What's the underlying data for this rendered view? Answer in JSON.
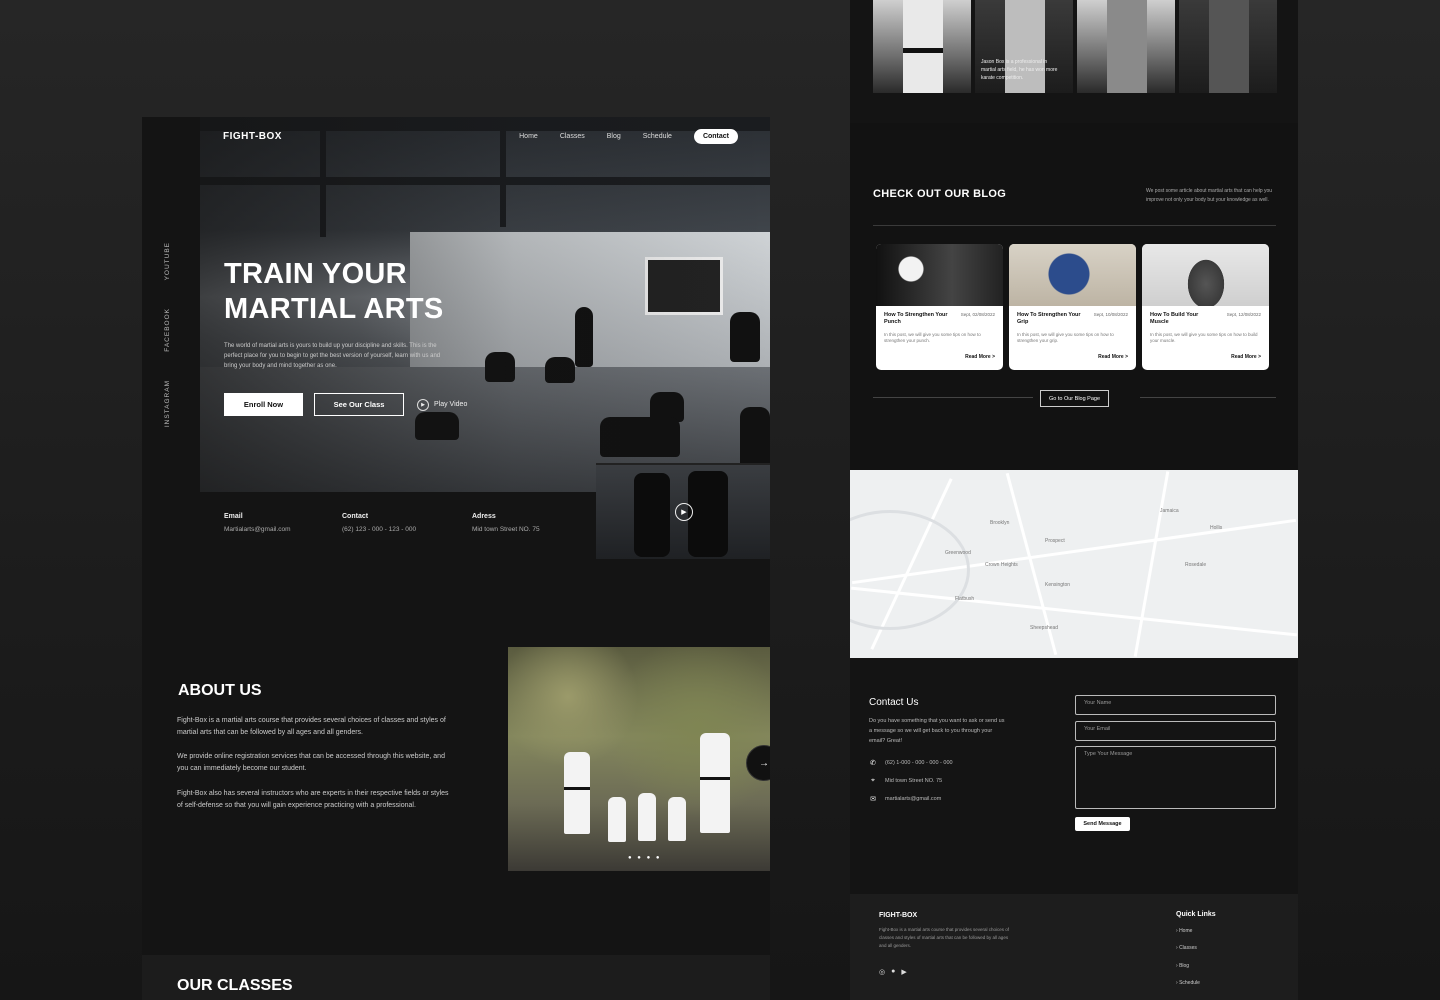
{
  "left": {
    "brand": "FIGHT-BOX",
    "nav": [
      "Home",
      "Classes",
      "Blog",
      "Schedule"
    ],
    "nav_contact": "Contact",
    "socials": [
      "YOUTUBE",
      "FACEBOOK",
      "INSTAGRAM"
    ],
    "hero_title_1": "TRAIN YOUR",
    "hero_title_2": "MARTIAL ARTS",
    "hero_text": "The world of martial arts is yours to build up your discipline and skills. This is the perfect place for you to begin to get the best version of yourself, learn with us and bring your body and mind together as one.",
    "btn_enroll": "Enroll Now",
    "btn_classes": "See Our Class",
    "btn_play": "Play Video",
    "info": {
      "email_label": "Email",
      "email_value": "Martialarts@gmail.com",
      "contact_label": "Contact",
      "contact_value": "(62) 123 - 000 - 123 - 000",
      "address_label": "Adress",
      "address_value": "Mid town Street NO. 75"
    },
    "about_title": "ABOUT US",
    "about_p1": "Fight-Box is a martial arts course that provides several choices of classes and styles of martial arts that can be followed by all ages and all genders.",
    "about_p2": "We provide online registration services that can be accessed through this website, and you can immediately become our student.",
    "about_p3": "Fight-Box also has several instructors who are experts in their respective fields or styles of self-defense so that you will gain experience practicing with a professional.",
    "classes_title": "OUR CLASSES"
  },
  "right": {
    "team_caption": "Jason Box is a professional in martial arts field, he has won more karate competition.",
    "blog_title": "CHECK OUT OUR BLOG",
    "blog_desc": "We post some article about martial arts that can help you improve not only your body but your knowledge as well.",
    "posts": [
      {
        "title": "How To Strengthen Your Punch",
        "date": "Sept, 02/08/2022",
        "text": "In this post, we will give you some tips on how to strengthen your punch.",
        "read": "Read More >"
      },
      {
        "title": "How To Strengthen Your Grip",
        "date": "Sept, 10/08/2022",
        "text": "In this post, we will give you some tips on how to strengthen your grip.",
        "read": "Read More >"
      },
      {
        "title": "How To Build Your Muscle",
        "date": "Sept, 12/08/2022",
        "text": "In this post, we will give you some tips on how to build your muscle.",
        "read": "Read More >"
      }
    ],
    "blog_btn": "Go to Our Blog Page",
    "contact_title": "Contact Us",
    "contact_text": "Do you have something that you want to ask or send us a message so we will get back to you through your email? Great!",
    "contact_phone": "(62) 1-000 - 000 - 000 - 000",
    "contact_address": "Mid town Street NO. 75",
    "contact_email": "martialarts@gmail.com",
    "field_name": "Your Name",
    "field_email": "Your Email",
    "field_message": "Type Your Message",
    "send_btn": "Send Message",
    "footer_brand": "FIGHT-BOX",
    "footer_text": "Fight-Box is a martial arts course that provides several choices of classes and styles of martial arts that can be followed by all ages and all genders.",
    "quick_links_title": "Quick Links",
    "quick_links": [
      "Home",
      "Classes",
      "Blog",
      "Schedule"
    ]
  }
}
